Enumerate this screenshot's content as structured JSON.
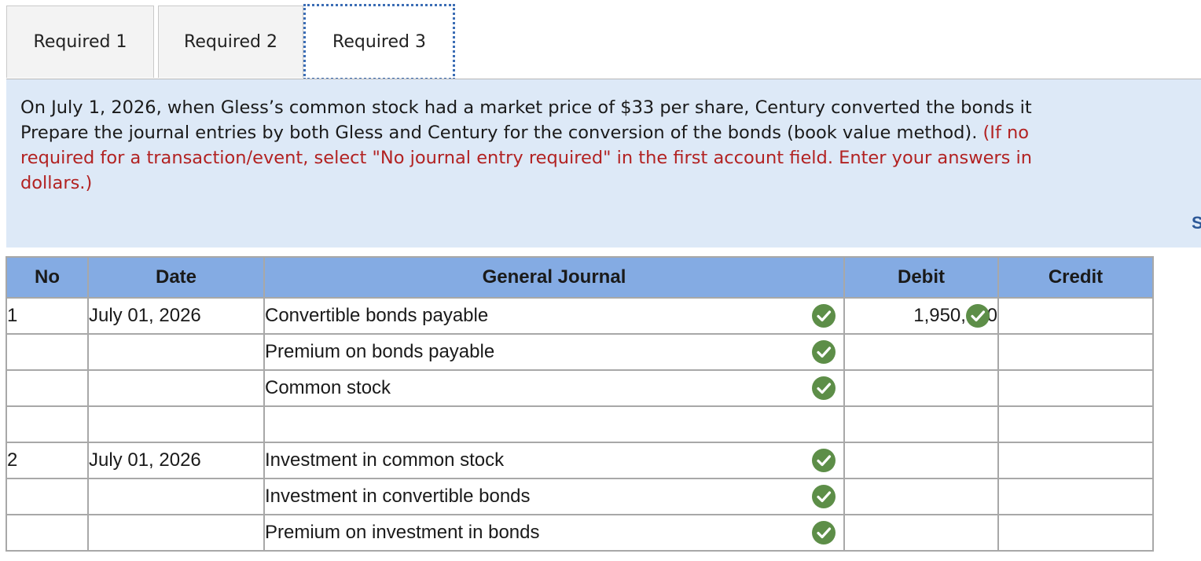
{
  "tabs": [
    {
      "label": "Required 1",
      "active": false
    },
    {
      "label": "Required 2",
      "active": false
    },
    {
      "label": "Required 3",
      "active": true
    }
  ],
  "instructions": {
    "line1": "On July 1, 2026, when Gless’s common stock had a market price of $33 per share, Century converted the bonds it",
    "line2_black": "Prepare the journal entries by both Gless and Century for the conversion of the bonds (book value method).",
    "line2_red": " (If no",
    "line3_red": "required for a transaction/event, select \"No journal entry required\" in the first account field. Enter your answers in",
    "line4_red": "dollars.)",
    "show_link": "Sh"
  },
  "table": {
    "headers": [
      "No",
      "Date",
      "General Journal",
      "Debit",
      "Credit"
    ],
    "rows": [
      {
        "no": "1",
        "date": "July 01, 2026",
        "account": "Convertible bonds payable",
        "debit": "1,950,000",
        "credit": "",
        "account_check": true,
        "debit_check": true
      },
      {
        "no": "",
        "date": "",
        "account": "Premium on bonds payable",
        "debit": "",
        "credit": "",
        "account_check": true,
        "debit_check": false
      },
      {
        "no": "",
        "date": "",
        "account": "Common stock",
        "debit": "",
        "credit": "",
        "account_check": true,
        "debit_check": false
      },
      {
        "no": "",
        "date": "",
        "account": "",
        "debit": "",
        "credit": "",
        "account_check": false,
        "debit_check": false
      },
      {
        "no": "2",
        "date": "July 01, 2026",
        "account": "Investment in common stock",
        "debit": "",
        "credit": "",
        "account_check": true,
        "debit_check": false
      },
      {
        "no": "",
        "date": "",
        "account": "Investment in convertible bonds",
        "debit": "",
        "credit": "",
        "account_check": true,
        "debit_check": false
      },
      {
        "no": "",
        "date": "",
        "account": "Premium on investment in bonds",
        "debit": "",
        "credit": "",
        "account_check": true,
        "debit_check": false
      }
    ]
  },
  "icons": {
    "check": "checkmark-circle-icon"
  },
  "colors": {
    "tab_active_border": "#3b6db5",
    "instructions_bg": "#dde9f7",
    "instruction_red": "#b22222",
    "table_header_bg": "#84abe3",
    "account_cell_bg": "#f4f8f0",
    "check_green": "#5d8e48"
  }
}
